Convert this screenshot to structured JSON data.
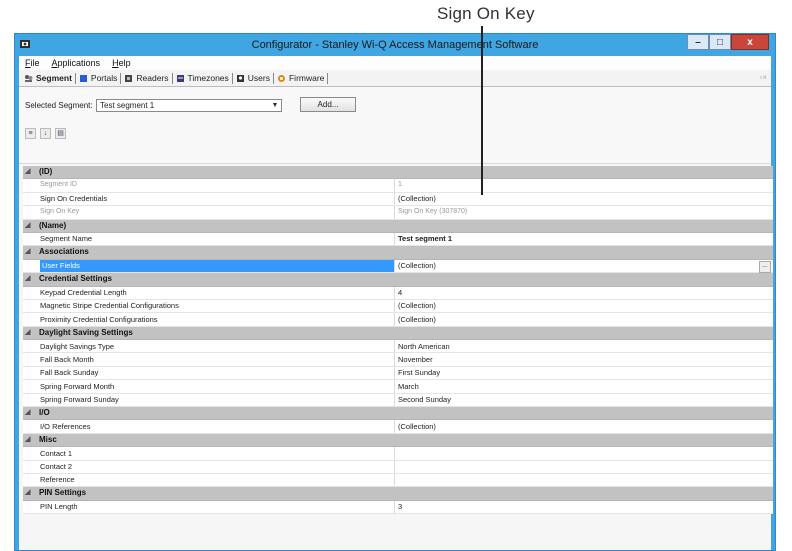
{
  "callout": "Sign On Key",
  "window": {
    "title": "Configurator - Stanley Wi-Q Access Management Software",
    "buttons": {
      "minimize": "–",
      "maximize": "□",
      "close": "x"
    }
  },
  "menu": [
    "File",
    "Applications",
    "Help"
  ],
  "tabs": [
    {
      "label": "Segment",
      "icon": "segment-icon",
      "active": true
    },
    {
      "label": "Portals",
      "icon": "portal-icon"
    },
    {
      "label": "Readers",
      "icon": "reader-icon"
    },
    {
      "label": "Timezones",
      "icon": "timezone-icon"
    },
    {
      "label": "Users",
      "icon": "user-icon"
    },
    {
      "label": "Firmware",
      "icon": "firmware-icon"
    }
  ],
  "segment": {
    "label": "Selected Segment:",
    "selected": "Test segment 1",
    "add_label": "Add..."
  },
  "colors": {
    "title_bar": "#3fa6e3",
    "category_row": "#c2c2c2",
    "selection": "#3399ff"
  },
  "grid": [
    {
      "type": "cat",
      "name": "(ID)"
    },
    {
      "type": "prop",
      "name": "Segment ID",
      "value": "1",
      "readonly": true
    },
    {
      "type": "prop",
      "name": "Sign On Credentials",
      "value": "(Collection)"
    },
    {
      "type": "prop",
      "name": "Sign On Key",
      "value": "Sign On Key (307870)",
      "readonly": true
    },
    {
      "type": "cat",
      "name": "(Name)"
    },
    {
      "type": "prop",
      "name": "Segment Name",
      "value": "Test segment 1",
      "bold": true
    },
    {
      "type": "cat",
      "name": "Associations"
    },
    {
      "type": "prop",
      "name": "User Fields",
      "value": "(Collection)",
      "selected": true
    },
    {
      "type": "cat",
      "name": "Credential Settings"
    },
    {
      "type": "prop",
      "name": "Keypad Credential Length",
      "value": "4"
    },
    {
      "type": "prop",
      "name": "Magnetic Stripe Credential Configurations",
      "value": "(Collection)"
    },
    {
      "type": "prop",
      "name": "Proximity Credential Configurations",
      "value": "(Collection)"
    },
    {
      "type": "cat",
      "name": "Daylight Saving Settings"
    },
    {
      "type": "prop",
      "name": "Daylight Savings Type",
      "value": "North American"
    },
    {
      "type": "prop",
      "name": "Fall Back Month",
      "value": "November"
    },
    {
      "type": "prop",
      "name": "Fall Back Sunday",
      "value": "First Sunday"
    },
    {
      "type": "prop",
      "name": "Spring Forward Month",
      "value": "March"
    },
    {
      "type": "prop",
      "name": "Spring Forward Sunday",
      "value": "Second Sunday"
    },
    {
      "type": "cat",
      "name": "I/O"
    },
    {
      "type": "prop",
      "name": "I/O References",
      "value": "(Collection)"
    },
    {
      "type": "cat",
      "name": "Misc"
    },
    {
      "type": "prop",
      "name": "Contact 1",
      "value": ""
    },
    {
      "type": "prop",
      "name": "Contact 2",
      "value": ""
    },
    {
      "type": "prop",
      "name": "Reference",
      "value": ""
    },
    {
      "type": "cat",
      "name": "PIN Settings"
    },
    {
      "type": "prop",
      "name": "PIN Length",
      "value": "3"
    }
  ]
}
